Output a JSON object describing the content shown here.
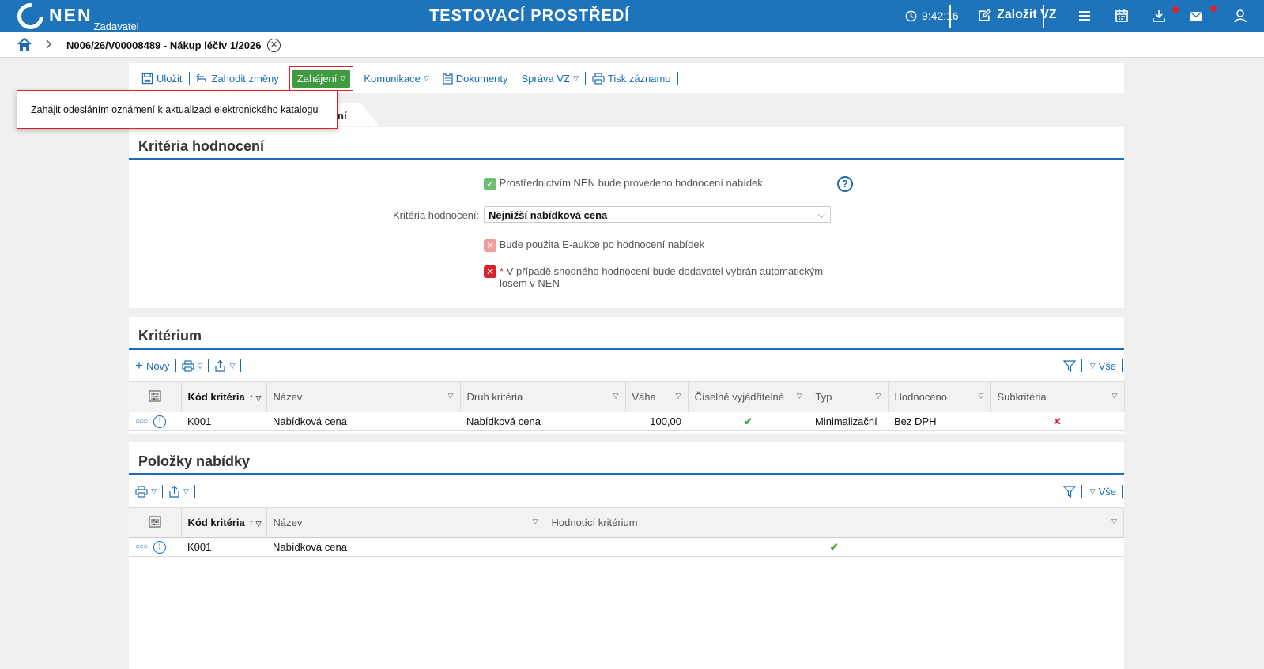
{
  "header": {
    "logo_text": "NEN",
    "logo_sub": "Zadavatel",
    "env_title": "TESTOVACÍ PROSTŘEDÍ",
    "clock": "9:42:16",
    "create_label": "Založit VZ",
    "icons": [
      "clock-icon",
      "edit-icon",
      "menu-icon",
      "calendar-icon",
      "download-icon",
      "mail-icon",
      "user-icon"
    ],
    "accent": "#1d74bb"
  },
  "breadcrumb": {
    "title": "N006/26/V00008489 - Nákup léčiv 1/2026"
  },
  "toolbar": {
    "save": "Uložit",
    "discard": "Zahodit změny",
    "start": "Zahájení",
    "communication": "Komunikace",
    "documents": "Dokumenty",
    "manage": "Správa VZ",
    "print": "Tisk záznamu"
  },
  "popup": {
    "text": "Zahájit odesláním oznámení k aktualizaci elektronického katalogu"
  },
  "tabstub": {
    "label": "ní"
  },
  "criteria_panel": {
    "title": "Kritéria hodnocení",
    "nen_eval": "Prostřednictvím NEN bude provedeno hodnocení nabídek",
    "criteria_label": "Kritéria hodnocení:",
    "criteria_value": "Nejnižší nabídková cena",
    "eauction": "Bude použita E-aukce po hodnocení nabídek",
    "lottery_required": "*",
    "lottery": "V případě shodného hodnocení bude dodavatel vybrán automatickým losem v NEN"
  },
  "criterion_panel": {
    "title": "Kritérium",
    "new_label": "Nový",
    "all_label": "Vše",
    "columns": [
      "Kód kritéria",
      "Název",
      "Druh kritéria",
      "Váha",
      "Číselně vyjádřitelné",
      "Typ",
      "Hodnoceno",
      "Subkritéria"
    ],
    "rows": [
      {
        "code": "K001",
        "name": "Nabídková cena",
        "kind": "Nabídková cena",
        "weight": "100,00",
        "numeric": true,
        "type": "Minimalizační",
        "evaluated": "Bez DPH",
        "sub": false
      }
    ]
  },
  "items_panel": {
    "title": "Položky nabídky",
    "all_label": "Vše",
    "columns": [
      "Kód kritéria",
      "Název",
      "Hodnotící kritérium"
    ],
    "rows": [
      {
        "code": "K001",
        "name": "Nabídková cena",
        "eval": true
      }
    ]
  }
}
